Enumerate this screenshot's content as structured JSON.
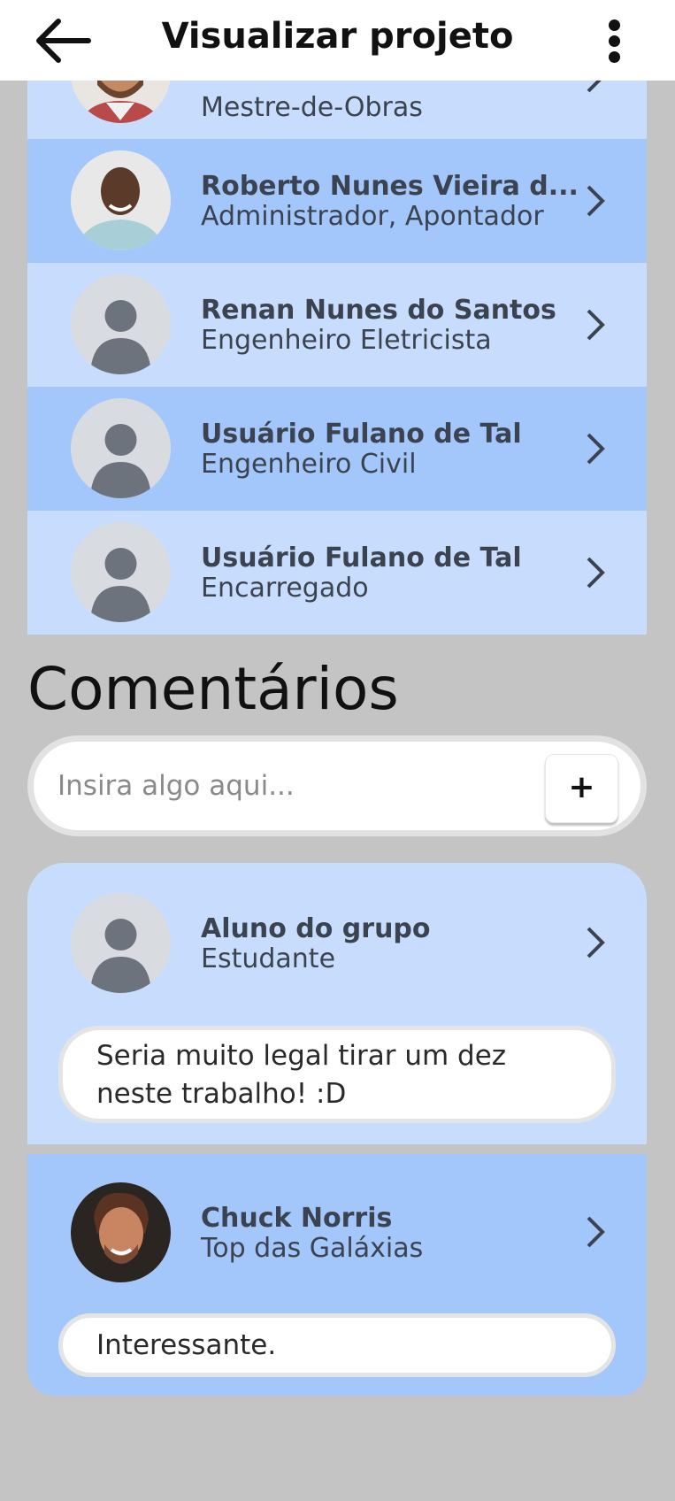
{
  "app_bar": {
    "title": "Visualizar projeto",
    "back_icon": "arrow-left-icon",
    "menu_icon": "more-vertical-icon"
  },
  "members": [
    {
      "name": "",
      "role": "Mestre-de-Obras",
      "avatar": "photo-bearded-man"
    },
    {
      "name": "Roberto Nunes Vieira d...",
      "role": "Administrador, Apontador",
      "avatar": "photo-smiling-man"
    },
    {
      "name": "Renan Nunes do Santos",
      "role": "Engenheiro Eletricista",
      "avatar": "default-user-icon"
    },
    {
      "name": "Usuário Fulano de Tal",
      "role": "Engenheiro Civil",
      "avatar": "default-user-icon"
    },
    {
      "name": "Usuário Fulano de Tal",
      "role": "Encarregado",
      "avatar": "default-user-icon"
    }
  ],
  "comments_section": {
    "title": "Comentários",
    "input_placeholder": "Insira algo aqui...",
    "input_value": "",
    "add_label": "+"
  },
  "comments": [
    {
      "author": "Aluno do grupo",
      "role": "Estudante",
      "text": "Seria muito legal tirar um dez neste trabalho! :D",
      "avatar": "default-user-icon"
    },
    {
      "author": "Chuck Norris",
      "role": "Top das Galáxias",
      "text": "Interessante.",
      "avatar": "photo-chuck-norris"
    }
  ],
  "colors": {
    "background": "#c4c4c4",
    "row_light": "#c8ddfd",
    "row_mid": "#a3c6fb",
    "text_dark": "#3b4250"
  }
}
